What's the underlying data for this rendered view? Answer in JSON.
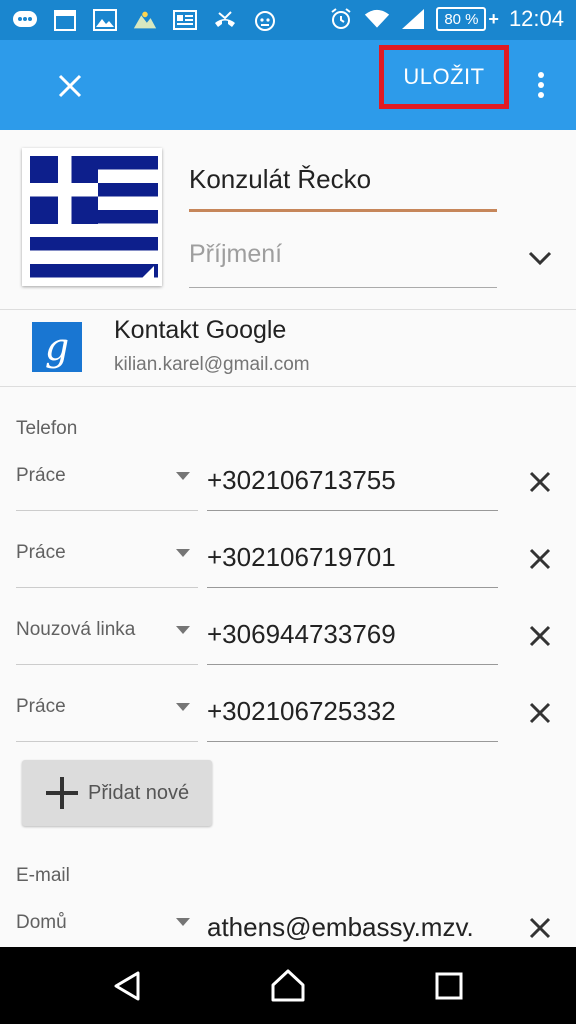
{
  "status_bar": {
    "battery": "80 %",
    "battery_plus": "+",
    "time": "12:04",
    "calendar_day": "1"
  },
  "toolbar": {
    "save_label": "ULOŽIT"
  },
  "contact": {
    "first_name": "Konzulát Řecko",
    "surname_placeholder": "Příjmení"
  },
  "account": {
    "icon_letter": "g",
    "title": "Kontakt Google",
    "email": "kilian.karel@gmail.com"
  },
  "phone_section": {
    "title": "Telefon",
    "entries": [
      {
        "type": "Práce",
        "number": "+302106713755"
      },
      {
        "type": "Práce",
        "number": "+302106719701"
      },
      {
        "type": "Nouzová linka",
        "number": "+306944733769"
      },
      {
        "type": "Práce",
        "number": "+302106725332"
      }
    ],
    "add_label": "Přidat nové"
  },
  "email_section": {
    "title": "E-mail",
    "entries": [
      {
        "type": "Domů",
        "address": "athens@embassy.mzv."
      }
    ]
  },
  "colors": {
    "app_bar": "#2d9bea",
    "status_bar": "#1a86cf",
    "highlight": "#e01b24",
    "name_underline": "#c6865a"
  }
}
